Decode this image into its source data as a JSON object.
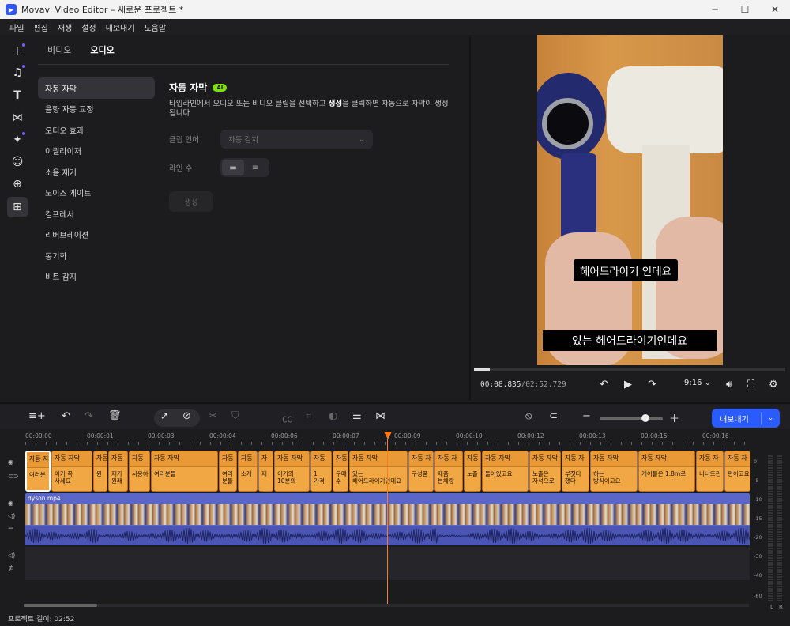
{
  "window": {
    "title": "Movavi Video Editor – 새로운 프로젝트 *",
    "minimize": "─",
    "maximize": "☐",
    "close": "✕"
  },
  "menu": [
    "파일",
    "편집",
    "재생",
    "설정",
    "내보내기",
    "도움말"
  ],
  "sidebar_icons": [
    "plus-icon",
    "music-icon",
    "text-icon",
    "transition-icon",
    "magic-wand-icon",
    "sticker-icon",
    "store-icon",
    "more-tools-icon"
  ],
  "panel": {
    "tabs": [
      "비디오",
      "오디오"
    ],
    "active_tab": "오디오",
    "categories": [
      "자동 자막",
      "음향 자동 교정",
      "오디오 효과",
      "이퀄라이저",
      "소음 제거",
      "노이즈 게이트",
      "컴프레서",
      "리버브레이션",
      "동기화",
      "비트 감지"
    ],
    "detail": {
      "title": "자동 자막",
      "ai_badge": "AI",
      "desc_part1": "타임라인에서 오디오 또는 비디오 클립을 선택하고 ",
      "desc_bold": "생성",
      "desc_part2": "을 클릭하면 자동으로 자막이 생성됩니다",
      "language_label": "클립 언어",
      "language_value": "자동 감지",
      "lines_label": "라인 수",
      "generate_label": "생성"
    }
  },
  "preview": {
    "subtitle_top": "헤어드라이기 인데요",
    "subtitle_bottom": "있는 헤어드라이기인데요",
    "time_current": "00:08.835",
    "time_total": "/02:52.729",
    "progress": 0.05,
    "aspect": "9:16",
    "aspect_caret": "⌄"
  },
  "timeline": {
    "export_label": "내보내기",
    "ruler": [
      "00:00:00",
      "00:00:01",
      "00:00:03",
      "00:00:04",
      "00:00:06",
      "00:00:07",
      "00:00:09",
      "00:00:10",
      "00:00:12",
      "00:00:13",
      "00:00:15",
      "00:00:16"
    ],
    "subtitle_clips": [
      {
        "title": "자동 자",
        "text": "여러분"
      },
      {
        "title": "자동 자막",
        "text": "이거 꼭\n사세요"
      },
      {
        "title": "자동",
        "text": "윈"
      },
      {
        "title": "자동",
        "text": "제가\n원래"
      },
      {
        "title": "자동",
        "text": "사용하"
      },
      {
        "title": "자동 자막",
        "text": "여러분들"
      },
      {
        "title": "자동",
        "text": "여러\n분들"
      },
      {
        "title": "자동",
        "text": "소개"
      },
      {
        "title": "자",
        "text": "제"
      },
      {
        "title": "자동 자막",
        "text": "이거의\n10분의"
      },
      {
        "title": "자동",
        "text": "1\n가격"
      },
      {
        "title": "자동",
        "text": "구매\n수"
      },
      {
        "title": "자동 자막",
        "text": "있는\n헤어드라이기인데요"
      },
      {
        "title": "자동 자",
        "text": "구성품"
      },
      {
        "title": "자동 자",
        "text": "제품\n본체랑"
      },
      {
        "title": "자동",
        "text": "노즐"
      },
      {
        "title": "자동 자막",
        "text": "들어있고요"
      },
      {
        "title": "자동 자막",
        "text": "노즐은\n자석으로"
      },
      {
        "title": "자동 자",
        "text": "부짓다\n했다"
      },
      {
        "title": "자동 자막",
        "text": "하는\n방식이고요"
      },
      {
        "title": "자동 자막",
        "text": "케이블은 1.8m로"
      },
      {
        "title": "자동 자",
        "text": "너너뜨린"
      },
      {
        "title": "자동 자",
        "text": "편이고요"
      }
    ],
    "video_label": "dyson.mp4",
    "vu_labels": [
      "0",
      "-5",
      "-10",
      "-15",
      "-20",
      "-30",
      "-40",
      "-60"
    ],
    "vu_lr": [
      "L",
      "R"
    ],
    "project_length": "프로젝트 길이: 02:52"
  }
}
